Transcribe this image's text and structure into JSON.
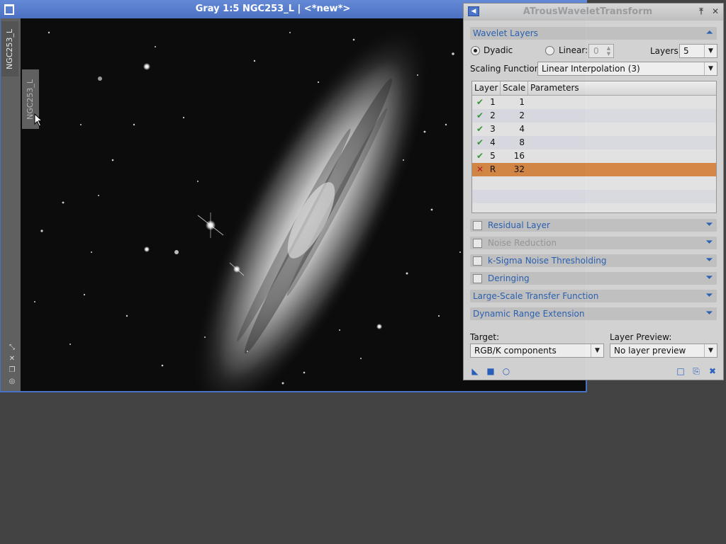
{
  "image_window": {
    "title": "Gray 1:5 NGC253_L | <*new*>",
    "view_tab": "NGC253_L",
    "preview_tab": "NGC253_L",
    "side_controls": [
      "zoom-fit-icon",
      "crosshair-icon",
      "restore-icon",
      "target-icon"
    ]
  },
  "panel": {
    "title": "ATrousWaveletTransform",
    "wavelet_layers": {
      "header": "Wavelet Layers",
      "dyadic_label": "Dyadic",
      "dyadic_selected": true,
      "linear_label": "Linear:",
      "linear_value": "0",
      "layers_label": "Layers:",
      "layers_value": "5",
      "scaling_label": "Scaling Function:",
      "scaling_value": "Linear Interpolation (3)"
    },
    "table": {
      "headers": [
        "Layer",
        "Scale",
        "Parameters"
      ],
      "rows": [
        {
          "status": "enabled",
          "icon": "✔",
          "layer": "1",
          "scale": "1",
          "params": ""
        },
        {
          "status": "enabled",
          "icon": "✔",
          "layer": "2",
          "scale": "2",
          "params": ""
        },
        {
          "status": "enabled",
          "icon": "✔",
          "layer": "3",
          "scale": "4",
          "params": ""
        },
        {
          "status": "enabled",
          "icon": "✔",
          "layer": "4",
          "scale": "8",
          "params": ""
        },
        {
          "status": "enabled",
          "icon": "✔",
          "layer": "5",
          "scale": "16",
          "params": ""
        },
        {
          "status": "disabled",
          "icon": "✕",
          "layer": "R",
          "scale": "32",
          "params": ""
        }
      ]
    },
    "sections": [
      {
        "label": "Residual Layer",
        "checkbox": true,
        "enabled": true
      },
      {
        "label": "Noise Reduction",
        "checkbox": true,
        "enabled": false
      },
      {
        "label": "k-Sigma Noise Thresholding",
        "checkbox": true,
        "enabled": true
      },
      {
        "label": "Deringing",
        "checkbox": true,
        "enabled": true
      },
      {
        "label": "Large-Scale Transfer Function",
        "checkbox": false,
        "enabled": true
      },
      {
        "label": "Dynamic Range Extension",
        "checkbox": false,
        "enabled": true
      }
    ],
    "target_label": "Target:",
    "target_value": "RGB/K components",
    "preview_label": "Layer Preview:",
    "preview_value": "No layer preview"
  },
  "colors": {
    "window_frame": "#4a72c4",
    "section_text": "#2d63b6",
    "selected_row": "#d98a48",
    "enabled_check": "#3a9a3a",
    "disabled_x": "#b32020"
  }
}
